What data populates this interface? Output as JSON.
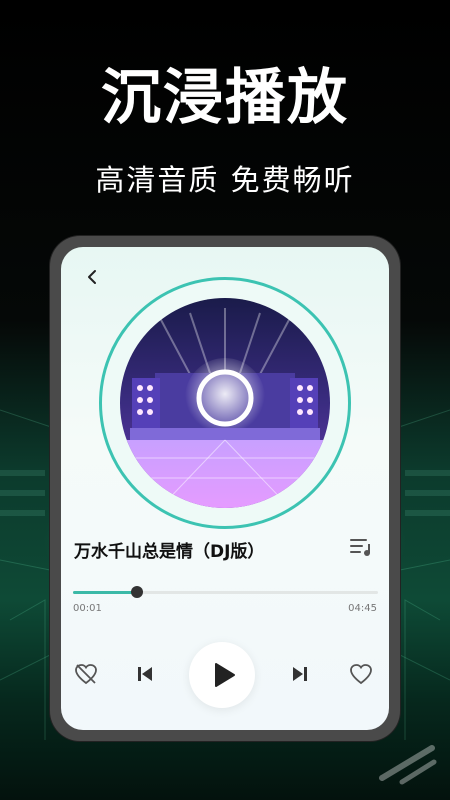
{
  "promo": {
    "headline": "沉浸播放",
    "subhead": "高清音质 免费畅听"
  },
  "player": {
    "song_title": "万水千山总是情（DJ版）",
    "elapsed": "00:01",
    "total": "04:45",
    "progress": 0.21,
    "icons": {
      "back": "chevron-left-icon",
      "playlist": "playlist-icon",
      "dislike": "heart-broken-icon",
      "previous": "previous-track-icon",
      "play": "play-icon",
      "next": "next-track-icon",
      "like": "heart-icon"
    }
  },
  "colors": {
    "accent": "#3bb9a7",
    "background_dark": "#000000",
    "stage_green": "#0e4a36"
  }
}
